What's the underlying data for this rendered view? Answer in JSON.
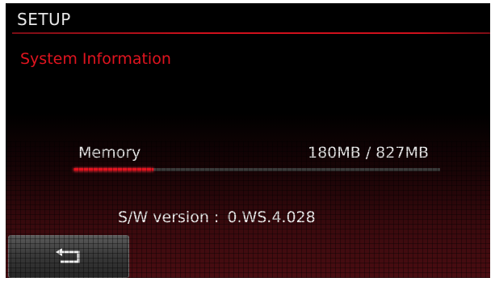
{
  "header": {
    "title": "SETUP"
  },
  "section": {
    "title": "System Information"
  },
  "memory": {
    "label": "Memory",
    "value": "180MB / 827MB",
    "used_fraction": 0.217
  },
  "software": {
    "label": "S/W version :",
    "value": "0.WS.4.028"
  },
  "back_button": {
    "icon": "return-arrow-icon"
  },
  "colors": {
    "accent": "#e0141f",
    "text": "#e8e8e8",
    "background": "#000000"
  }
}
